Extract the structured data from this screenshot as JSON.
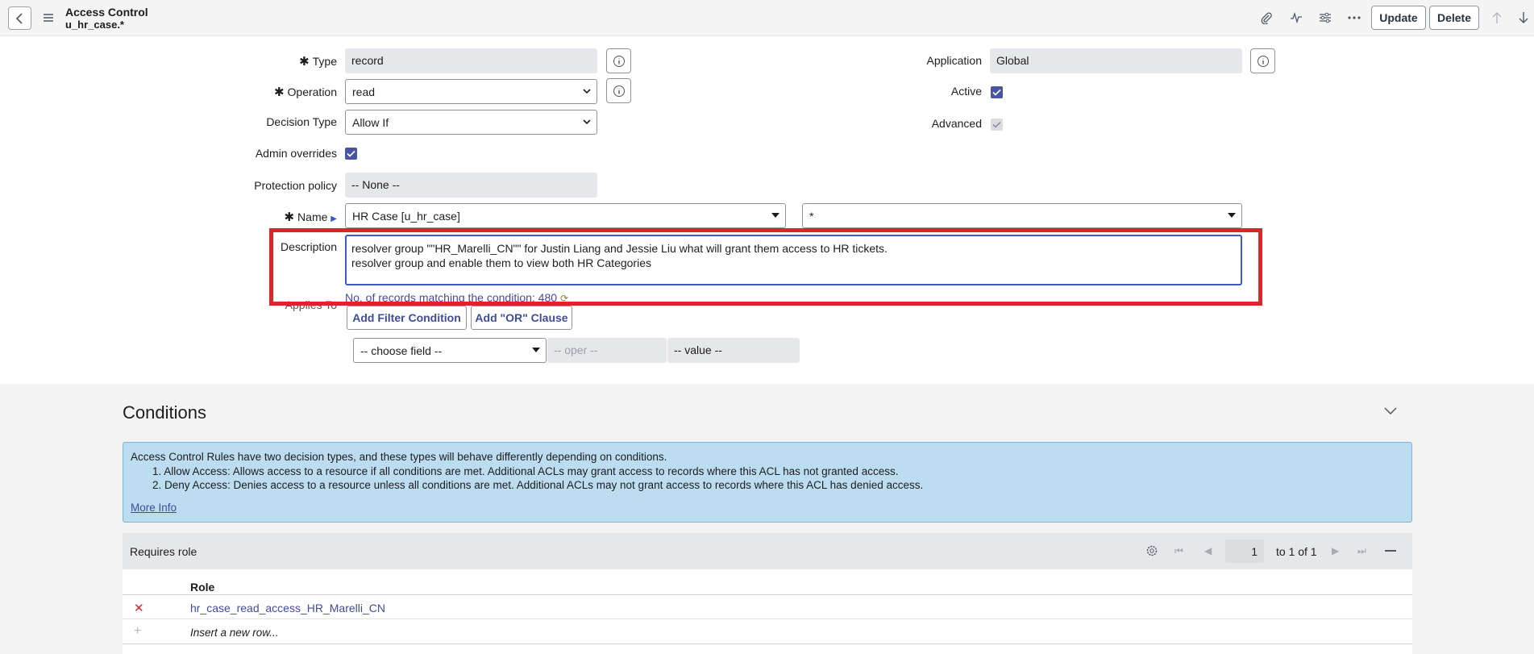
{
  "header": {
    "title": "Access Control",
    "subtitle": "u_hr_case.*",
    "update_label": "Update",
    "delete_label": "Delete"
  },
  "form": {
    "type_label": "Type",
    "type_value": "record",
    "operation_label": "Operation",
    "operation_value": "read",
    "decision_type_label": "Decision Type",
    "decision_type_value": "Allow If",
    "admin_overrides_label": "Admin overrides",
    "admin_overrides_checked": true,
    "protection_policy_label": "Protection policy",
    "protection_policy_value": "-- None --",
    "application_label": "Application",
    "application_value": "Global",
    "active_label": "Active",
    "active_checked": true,
    "advanced_label": "Advanced",
    "advanced_checked": true,
    "name_label": "Name",
    "name_table_value": "HR Case [u_hr_case]",
    "name_field_value": "*",
    "description_label": "Description",
    "description_line1": "resolver group \"\"HR_Marelli_CN\"\" for Justin Liang and Jessie Liu what will grant them access to HR tickets.",
    "description_line2": "resolver group and enable them to view both HR Categories",
    "applies_to_label": "Applies To",
    "records_link": "No. of records matching the condition: 480",
    "add_filter_label": "Add Filter Condition",
    "add_or_label": "Add \"OR\" Clause",
    "choose_field": "-- choose field --",
    "oper_placeholder": "-- oper --",
    "value_placeholder": "-- value --"
  },
  "conditions": {
    "title": "Conditions",
    "info_intro": "Access Control Rules have two decision types, and these types will behave differently depending on conditions.",
    "info_item1": "1. Allow Access: Allows access to a resource if all conditions are met. Additional ACLs may grant access to records where this ACL has not granted access.",
    "info_item2": "2. Deny Access: Denies access to a resource unless all conditions are met. Additional ACLs may not grant access to records where this ACL has denied access.",
    "more_info": "More Info"
  },
  "related_list": {
    "title": "Requires role",
    "page_value": "1",
    "page_range": "to 1 of 1",
    "column_role": "Role",
    "rows": [
      {
        "role": "hr_case_read_access_HR_Marelli_CN"
      }
    ],
    "insert_row": "Insert a new row..."
  },
  "colors": {
    "accent": "#4a55a2",
    "highlight": "#d9262a",
    "info_bg": "#bcdcf0",
    "link": "#3e4c9b"
  }
}
